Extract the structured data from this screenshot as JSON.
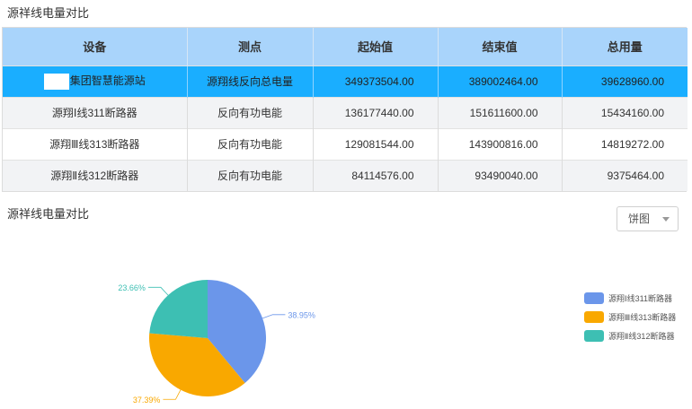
{
  "page": {
    "title_top": "源祥线电量对比",
    "title_chart": "源祥线电量对比"
  },
  "table": {
    "headers": [
      "设备",
      "测点",
      "起始值",
      "结束值",
      "总用量"
    ],
    "rows": [
      {
        "device": "集团智慧能源站",
        "point": "源翔线反向总电量",
        "start": "349373504.00",
        "end": "389002464.00",
        "total": "39628960.00"
      },
      {
        "device": "源翔Ⅰ线311断路器",
        "point": "反向有功电能",
        "start": "136177440.00",
        "end": "151611600.00",
        "total": "15434160.00"
      },
      {
        "device": "源翔Ⅲ线313断路器",
        "point": "反向有功电能",
        "start": "129081544.00",
        "end": "143900816.00",
        "total": "14819272.00"
      },
      {
        "device": "源翔Ⅱ线312断路器",
        "point": "反向有功电能",
        "start": "84114576.00",
        "end": "93490040.00",
        "total": "9375464.00"
      }
    ]
  },
  "chart_type_select": {
    "value": "饼图",
    "icon": "chevron-down-icon"
  },
  "chart_data": {
    "type": "pie",
    "labels": [
      "源翔Ⅰ线311断路器",
      "源翔Ⅲ线313断路器",
      "源翔Ⅱ线312断路器"
    ],
    "values": [
      38.95,
      37.39,
      23.66
    ],
    "value_labels": [
      "38.95%",
      "37.39%",
      "23.66%"
    ],
    "colors": [
      "#6b96ea",
      "#f9a800",
      "#3dbfb3"
    ],
    "legend": "right"
  }
}
